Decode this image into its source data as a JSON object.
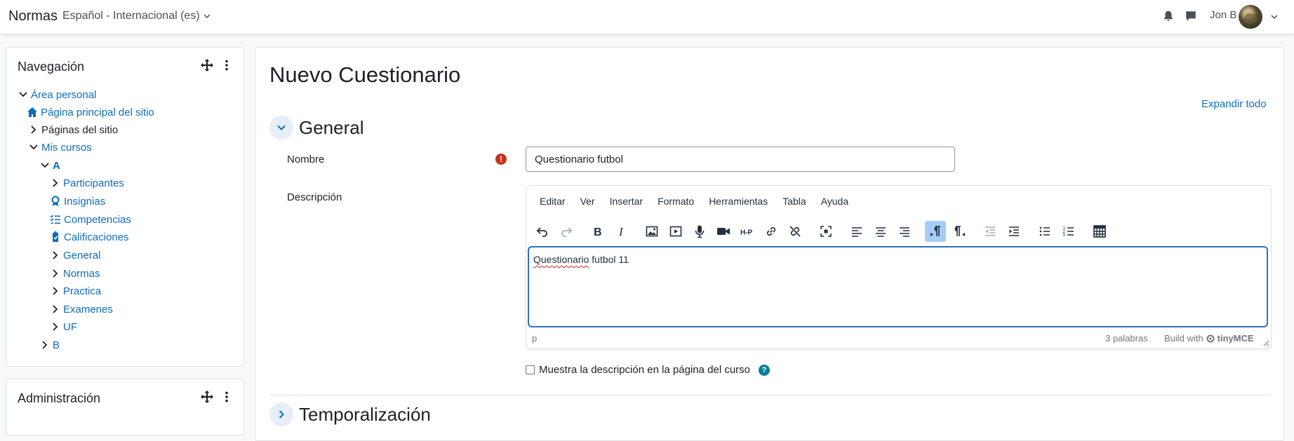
{
  "navbar": {
    "brand": "Normas",
    "language": "Español - Internacional (es)",
    "username": "Jon B"
  },
  "navigation_block": {
    "title": "Navegación",
    "items": [
      {
        "label": "Área personal",
        "type": "link"
      },
      {
        "label": "Página principal del sitio",
        "type": "link"
      },
      {
        "label": "Páginas del sitio",
        "type": "text"
      },
      {
        "label": "Mis cursos",
        "type": "link"
      },
      {
        "label": "A",
        "type": "link"
      },
      {
        "label": "Participantes",
        "type": "link"
      },
      {
        "label": "Insignias",
        "type": "link"
      },
      {
        "label": "Competencias",
        "type": "link"
      },
      {
        "label": "Calificaciones",
        "type": "link"
      },
      {
        "label": "General",
        "type": "link"
      },
      {
        "label": "Normas",
        "type": "link"
      },
      {
        "label": "Practica",
        "type": "link"
      },
      {
        "label": "Examenes",
        "type": "link"
      },
      {
        "label": "UF",
        "type": "link"
      },
      {
        "label": "B",
        "type": "link"
      }
    ]
  },
  "admin_block": {
    "title": "Administración"
  },
  "main": {
    "page_title": "Nuevo Cuestionario",
    "expand_all": "Expandir todo",
    "section_general": "General",
    "section_timing": "Temporalización",
    "name_label": "Nombre",
    "name_value": "Questionario futbol",
    "description_label": "Descripción",
    "editor": {
      "menus": [
        "Editar",
        "Ver",
        "Insertar",
        "Formato",
        "Herramientas",
        "Tabla",
        "Ayuda"
      ],
      "content_word1": "Questionario",
      "content_rest": " futbol 11",
      "path": "p",
      "word_count": "3 palabras",
      "build_with": "Build with",
      "brand": "tinyMCE"
    },
    "show_description_label": "Muestra la descripción en la página del curso"
  },
  "colors": {
    "link": "#0f6cbf",
    "required": "#ca3120",
    "help": "#008196",
    "editor_focus": "#2d6fc2",
    "active_toolbar": "#a6ccf7"
  }
}
